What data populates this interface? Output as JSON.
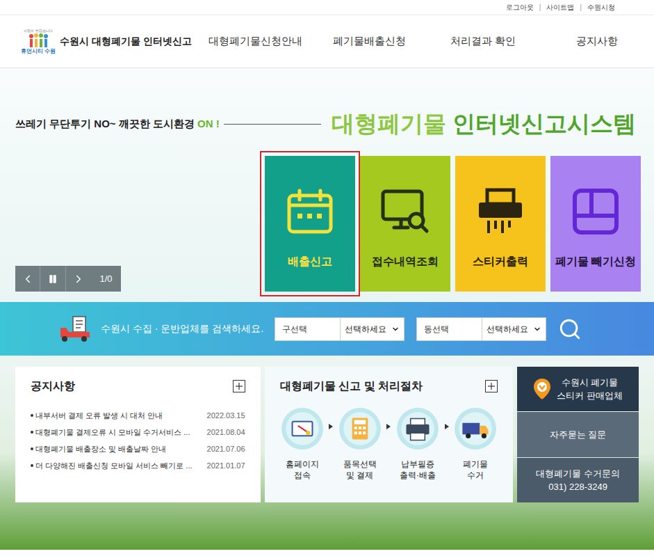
{
  "utility": {
    "links": [
      "로그아웃",
      "사이트맵",
      "수원시청"
    ],
    "separator": "|"
  },
  "logo": {
    "tagline": "사람이 반갑습니다",
    "brand": "휴먼시티 수원",
    "title": "수원시 대형폐기물 인터넷신고"
  },
  "nav": [
    "대형폐기물신청안내",
    "폐기물배출신청",
    "처리결과 확인",
    "공지사항"
  ],
  "hero": {
    "slogan": "쓰레기 무단투기 NO~ 깨끗한 도시환경",
    "slogan_accent": "ON !",
    "title_light": "대형폐기물",
    "title_dark": "인터넷신고시스템"
  },
  "slider": {
    "counter": "1/0"
  },
  "tiles": [
    {
      "label": "배출신고",
      "color": "#13a08b",
      "text_color": "#ffe23d",
      "highlighted": true
    },
    {
      "label": "접수내역조회",
      "color": "#a6c91f",
      "text_color": "#1f2a10",
      "highlighted": false
    },
    {
      "label": "스티커출력",
      "color": "#f6c21c",
      "text_color": "#2a2208",
      "highlighted": false
    },
    {
      "label": "폐기물 빼기신청",
      "color": "#a981f1",
      "text_color": "#1f1238",
      "highlighted": false
    }
  ],
  "search": {
    "label": "수원시 수집 · 운반업체를 검색하세요.",
    "fields": [
      {
        "value": "구선택",
        "select": "선택하세요"
      },
      {
        "value": "동선택",
        "select": "선택하세요"
      }
    ]
  },
  "notices": {
    "title": "공지사항",
    "items": [
      {
        "title": "내부서버 결제 오류 발생 시 대처 안내",
        "date": "2022.03.15"
      },
      {
        "title": "대형폐기물 결제오류 시 모바일 수거서비스 ...",
        "date": "2021.08.04"
      },
      {
        "title": "대형폐기물 배출장소 및 배출날짜 안내",
        "date": "2021.07.06"
      },
      {
        "title": "더 다양해진 배출신청 모바일 서비스 빼기로 ...",
        "date": "2021.01.07"
      }
    ]
  },
  "process": {
    "title": "대형폐기물 신고 및 처리절차",
    "steps": [
      {
        "lines": [
          "홈페이지",
          "접속"
        ]
      },
      {
        "lines": [
          "품목선택",
          "및 결제"
        ]
      },
      {
        "lines": [
          "납부필증",
          "출력·배출"
        ]
      },
      {
        "lines": [
          "폐기물",
          "수거"
        ]
      }
    ]
  },
  "quick_links": [
    {
      "lines": [
        "수원시 폐기물",
        "스티커 판매업체"
      ],
      "color": "#27384a",
      "pin": true
    },
    {
      "lines": [
        "자주묻는 질문"
      ],
      "color": "#5a6a78",
      "pin": false
    },
    {
      "lines": [
        "대형폐기물 수거문의",
        "031) 228-3249"
      ],
      "color": "#4b5b69",
      "pin": false
    }
  ]
}
